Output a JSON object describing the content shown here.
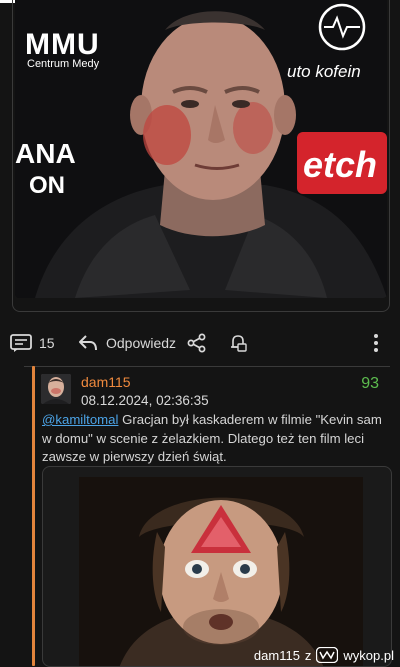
{
  "post": {
    "image_banner_left_top": "MMU",
    "image_banner_left_sub": "Centrum Medy",
    "image_banner_left_mid1": "ANA",
    "image_banner_left_mid2": "ON",
    "image_banner_right_top": "uto kofein",
    "image_banner_right_mid": "etch"
  },
  "actions": {
    "comments_count": "15",
    "reply_label": "Odpowiedz"
  },
  "reply": {
    "username": "dam115",
    "timestamp": "08.12.2024, 02:36:35",
    "score": "93",
    "mention": "@kamiltomal",
    "text": " Gracjan był kaskaderem w filmie \"Kevin sam w domu\" w scenie z żelazkiem. Dlatego też ten film leci zawsze w pierwszy dzień świąt."
  },
  "watermark": {
    "user": "dam115",
    "sep": "z",
    "site": "wykop.pl"
  },
  "colors": {
    "background": "#141414",
    "username": "#f08a3e",
    "score": "#5dbd4f",
    "mention": "#4ca3e6",
    "thread_bar": "#e2843c"
  }
}
